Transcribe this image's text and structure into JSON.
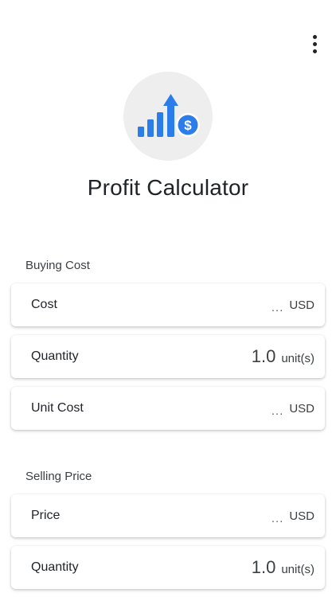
{
  "app": {
    "title": "Profit Calculator"
  },
  "buying": {
    "label": "Buying Cost",
    "cost": {
      "label": "Cost",
      "placeholder": "...",
      "unit": "USD"
    },
    "quantity": {
      "label": "Quantity",
      "value": "1.0",
      "unit": "unit(s)"
    },
    "unit_cost": {
      "label": "Unit Cost",
      "placeholder": "...",
      "unit": "USD"
    }
  },
  "selling": {
    "label": "Selling Price",
    "price": {
      "label": "Price",
      "placeholder": "...",
      "unit": "USD"
    },
    "quantity": {
      "label": "Quantity",
      "value": "1.0",
      "unit": "unit(s)"
    }
  },
  "icons": {
    "menu": "more-vert-icon",
    "logo": "chart-up-dollar-icon"
  },
  "colors": {
    "accent": "#2b7de9",
    "logo_bg": "#eeeeee",
    "text": "#1f2328"
  }
}
